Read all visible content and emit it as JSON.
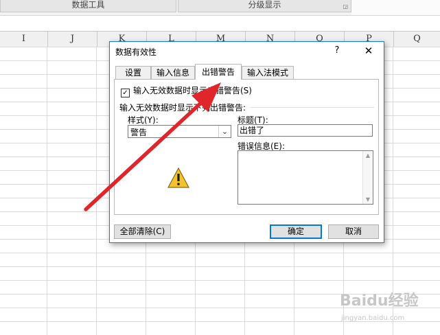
{
  "ribbon": {
    "groups": [
      {
        "label": "数据工具"
      },
      {
        "label": "分级显示"
      }
    ]
  },
  "columns": [
    "I",
    "J",
    "K",
    "L",
    "M",
    "N",
    "O",
    "P",
    "Q"
  ],
  "dialog": {
    "title": "数据有效性",
    "help_label": "?",
    "close_label": "✕",
    "tabs": [
      {
        "label": "设置"
      },
      {
        "label": "输入信息"
      },
      {
        "label": "出错警告",
        "active": true
      },
      {
        "label": "输入法模式"
      }
    ],
    "show_error_checkbox": {
      "label": "输入无效数据时显示出错警告(S)",
      "checked": true
    },
    "section_label": "输入无效数据时显示下列出错警告:",
    "style_label": "样式(Y):",
    "style_value": "警告",
    "title_label": "标题(T):",
    "title_value": "出错了",
    "message_label": "错误信息(E):",
    "message_value": "",
    "warning_icon": "warning-triangle-icon",
    "clear_all_button": "全部清除(C)",
    "ok_button": "确定",
    "cancel_button": "取消"
  },
  "annotation": {
    "icon": "red-arrow",
    "color": "#e0262a"
  },
  "watermark": {
    "logo": "Baidu经验",
    "url": "jingyan.baidu.com"
  }
}
